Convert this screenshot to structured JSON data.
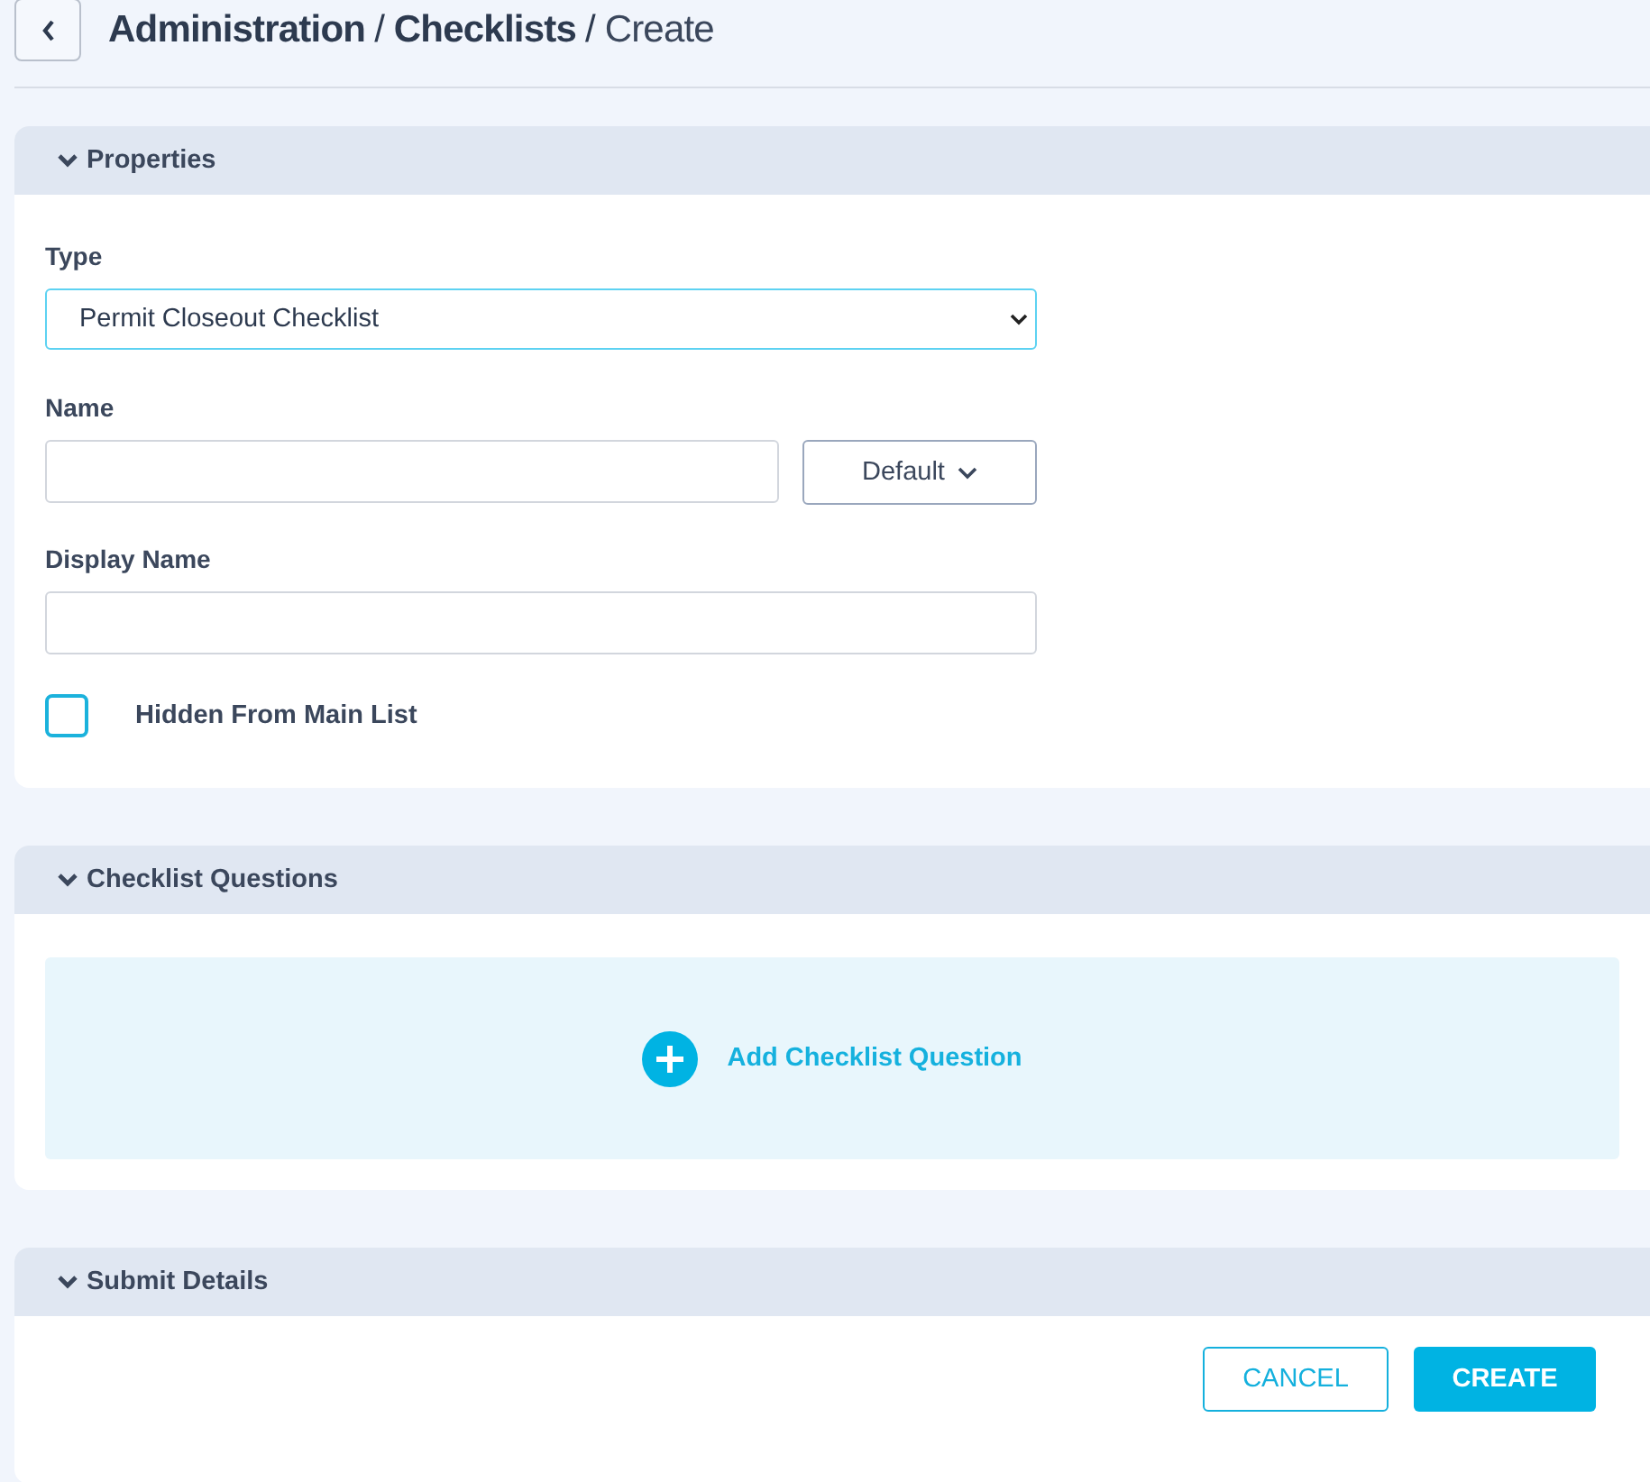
{
  "header": {
    "breadcrumbs": [
      {
        "label": "Administration",
        "current": false
      },
      {
        "label": "Checklists",
        "current": false
      },
      {
        "label": "Create",
        "current": true
      }
    ],
    "separator": "/"
  },
  "properties": {
    "title": "Properties",
    "expanded": true,
    "type": {
      "label": "Type",
      "value": "Permit Closeout Checklist"
    },
    "name": {
      "label": "Name",
      "button": "Default"
    },
    "display_name": {
      "label": "Display Name"
    },
    "hidden_from_main_list": {
      "label": "Hidden From Main List",
      "checked": false
    }
  },
  "checklist_questions": {
    "title": "Checklist Questions",
    "expanded": true,
    "add_label": "Add Checklist Question"
  },
  "submit_details": {
    "title": "Submit Details",
    "expanded": true,
    "buttons": [
      {
        "label": "CANCEL",
        "kind": "outline"
      },
      {
        "label": "CREATE",
        "kind": "primary"
      }
    ]
  }
}
